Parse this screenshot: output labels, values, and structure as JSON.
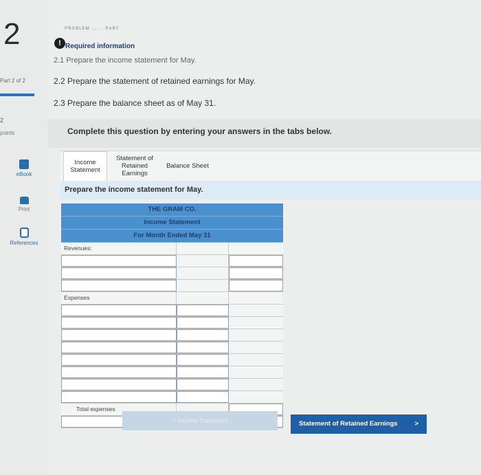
{
  "question": {
    "number": "2",
    "part": "Part 2 of 2",
    "points_number": "2",
    "points_label": "points",
    "header_scribble": "ᴘʀᴏʙʟᴇᴍ ..... ᴘᴀʀᴛ",
    "info_icon": "!",
    "required_info": "Required information",
    "items": [
      "2.1 Prepare the income statement for May.",
      "2.2 Prepare the statement of retained earnings for May.",
      "2.3 Prepare the balance sheet as of May 31."
    ],
    "instruction": "Complete this question by entering your answers in the tabs below."
  },
  "sidebar": {
    "ebook": "eBook",
    "print": "Print",
    "references": "References"
  },
  "tabs": [
    {
      "label_line1": "Income",
      "label_line2": "Statement",
      "label_line3": "",
      "active": true
    },
    {
      "label_line1": "Statement of",
      "label_line2": "Retained",
      "label_line3": "Earnings",
      "active": false
    },
    {
      "label_line1": "Balance Sheet",
      "label_line2": "",
      "label_line3": "",
      "active": false
    }
  ],
  "panel": {
    "subheading": "Prepare the income statement for May.",
    "company": "THE GRAM CO.",
    "statement": "Income Statement",
    "period": "For Month Ended May 31",
    "revenues_label": "Revenues:",
    "expenses_label": "Expenses",
    "total_expenses_label": "Total expenses"
  },
  "nav": {
    "prev_label": "< Income Statement",
    "next_label": "Statement of Retained Earnings",
    "next_chevron": ">"
  },
  "colors": {
    "header_blue": "#4a90cf",
    "primary_button": "#1e5fa6",
    "accent_blue": "#2d72c2"
  }
}
